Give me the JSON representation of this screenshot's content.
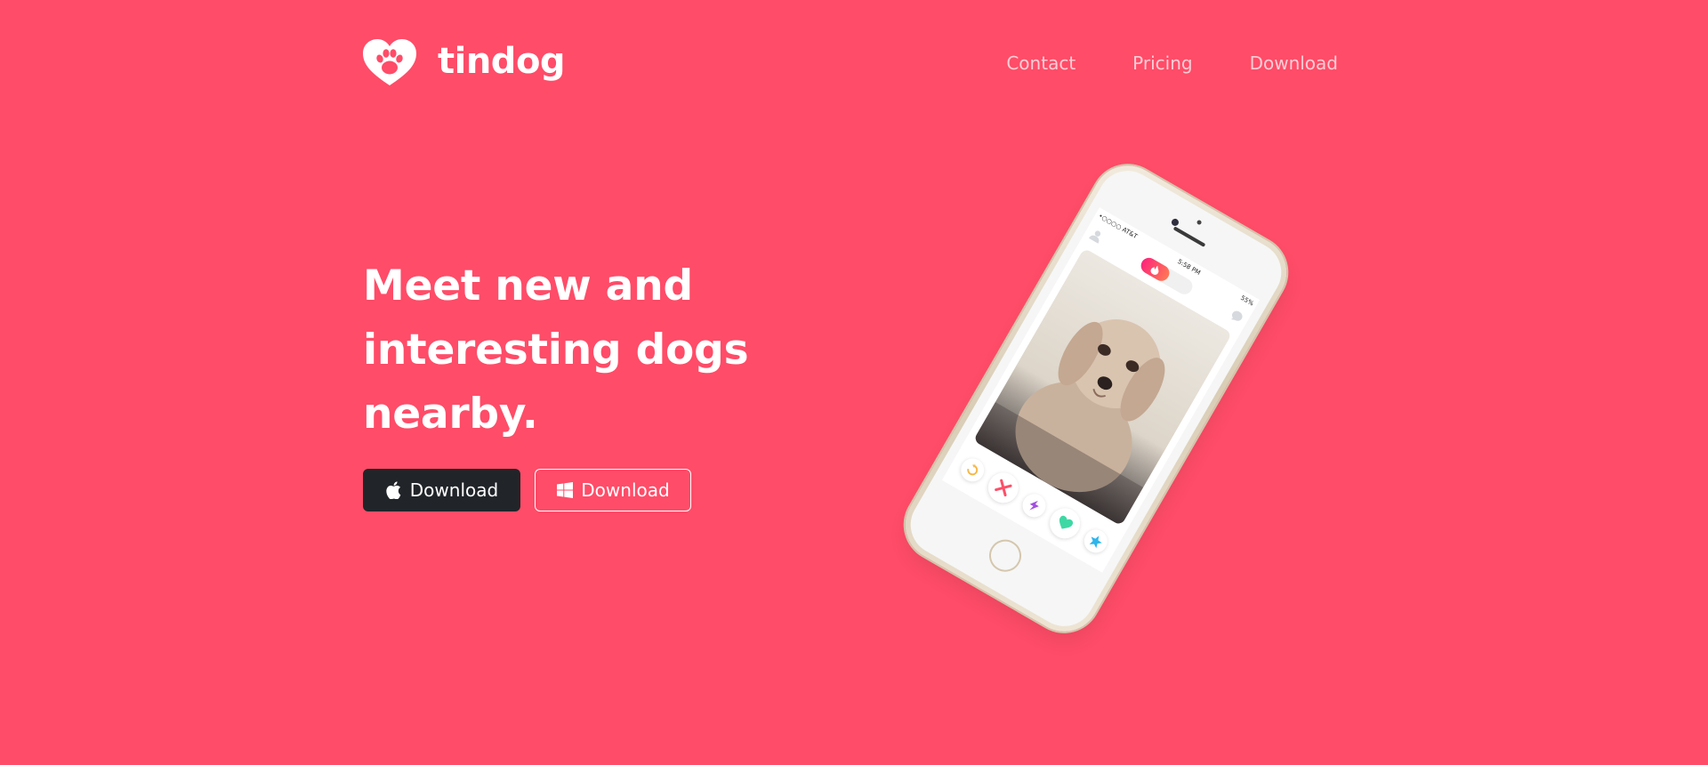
{
  "brand": {
    "name": "tindog",
    "logo_icon": "dog-paw-heart-icon"
  },
  "nav": {
    "links": [
      {
        "label": "Contact"
      },
      {
        "label": "Pricing"
      },
      {
        "label": "Download"
      }
    ]
  },
  "hero": {
    "title": "Meet new and interesting dogs nearby.",
    "buttons": [
      {
        "label": "Download",
        "icon": "apple-icon",
        "style": "dark"
      },
      {
        "label": "Download",
        "icon": "windows-icon",
        "style": "outline"
      }
    ]
  },
  "phone": {
    "status": {
      "carrier": "•○○○○ AT&T",
      "time": "5:58 PM",
      "battery": "55%"
    },
    "actions": [
      "rewind-icon",
      "nope-icon",
      "boost-icon",
      "like-icon",
      "super-like-icon"
    ]
  },
  "colors": {
    "background": "#ff4c68",
    "button_dark": "#212529",
    "text": "#ffffff"
  }
}
